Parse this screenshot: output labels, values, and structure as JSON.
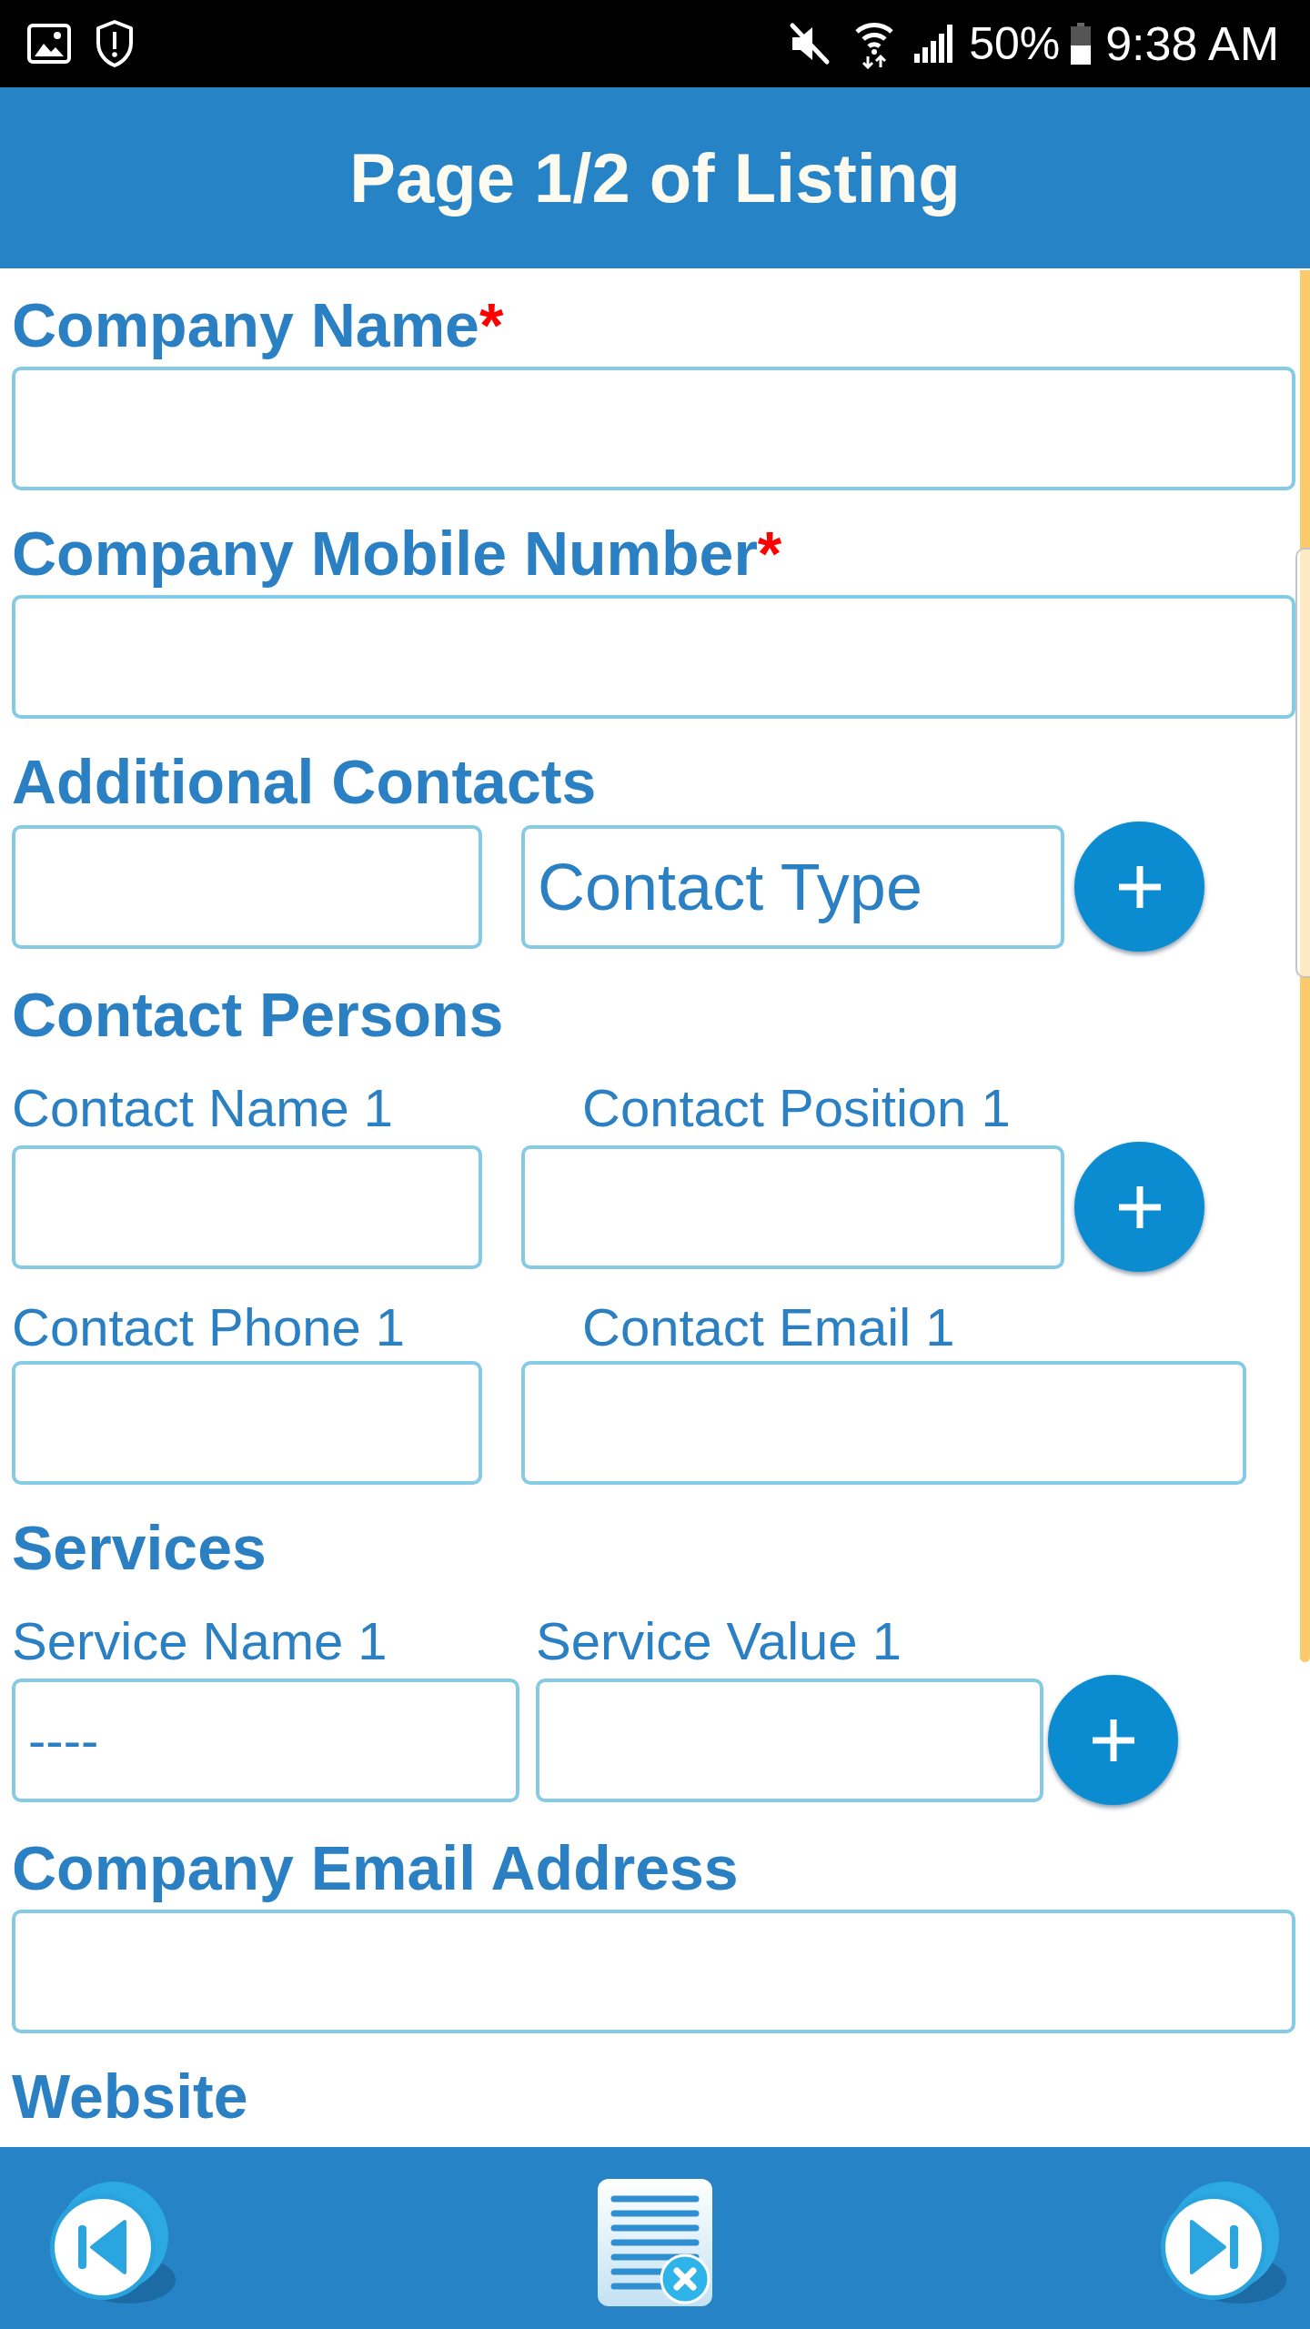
{
  "status_bar": {
    "battery": "50%",
    "time": "9:38 AM"
  },
  "header": {
    "title": "Page 1/2 of Listing"
  },
  "sections": [
    {
      "kind": "single",
      "label": "Company Name",
      "required_mark": "*"
    },
    {
      "kind": "single",
      "label": "Company Mobile Number",
      "required_mark": "*"
    },
    {
      "kind": "contacts",
      "label": "Additional Contacts",
      "rows": [
        {
          "cells": [
            {
              "kind": "input"
            },
            {
              "kind": "dropdown",
              "value": "Contact Type"
            }
          ],
          "add_button": true
        }
      ]
    },
    {
      "kind": "contacts",
      "label": "Contact Persons",
      "rows": [
        {
          "cells": [
            {
              "kind": "input",
              "label": "Contact Name 1"
            },
            {
              "kind": "input",
              "label": "Contact Position 1"
            }
          ],
          "add_button": true
        },
        {
          "cells": [
            {
              "kind": "input",
              "label": "Contact Phone 1"
            },
            {
              "kind": "input",
              "label": "Contact Email 1"
            }
          ],
          "add_button": false
        }
      ]
    },
    {
      "kind": "services",
      "label": "Services",
      "rows": [
        {
          "cells": [
            {
              "kind": "input",
              "label": "Service Name 1",
              "value": "----"
            },
            {
              "kind": "input",
              "label": "Service Value 1"
            }
          ],
          "add_button": true
        }
      ]
    },
    {
      "kind": "single",
      "label": "Company Email Address"
    },
    {
      "kind": "label",
      "label": "Website"
    }
  ]
}
